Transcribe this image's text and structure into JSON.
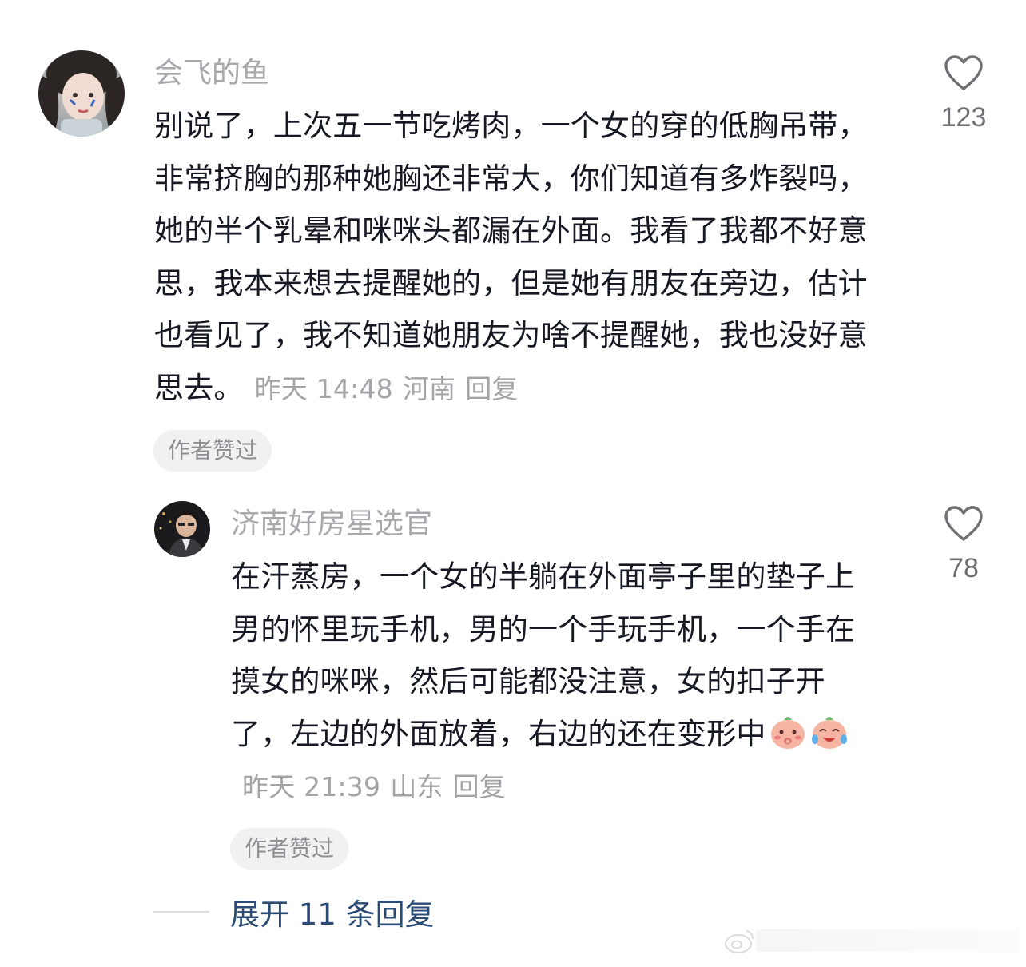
{
  "comments": [
    {
      "username": "会飞的鱼",
      "text": "别说了，上次五一节吃烤肉，一个女的穿的低胸吊带，非常挤胸的那种她胸还非常大，你们知道有多炸裂吗，她的半个乳晕和咪咪头都漏在外面。我看了我都不好意思，我本来想去提醒她的，但是她有朋友在旁边，估计也看见了，我不知道她朋友为啥不提醒她，我也没好意思去。",
      "time": "昨天 14:48",
      "location": "河南",
      "reply_label": "回复",
      "badge": "作者赞过",
      "like_count": "123",
      "like_icon": "heart-outline-icon"
    },
    {
      "username": "济南好房星选官",
      "text": "在汗蒸房，一个女的半躺在外面亭子里的垫子上男的怀里玩手机，男的一个手玩手机，一个手在摸女的咪咪，然后可能都没注意，女的扣子开了，左边的外面放着，右边的还在变形中",
      "emojis": [
        "sticker-shy-icon",
        "sticker-laugh-cry-icon"
      ],
      "time": "昨天 21:39",
      "location": "山东",
      "reply_label": "回复",
      "badge": "作者赞过",
      "like_count": "78",
      "like_icon": "heart-outline-icon"
    }
  ],
  "expand_replies": "展开 11 条回复",
  "colors": {
    "text": "#161823",
    "muted": "#a8a8ad",
    "link": "#2b4b74",
    "badge_bg": "#f1f1f2"
  }
}
